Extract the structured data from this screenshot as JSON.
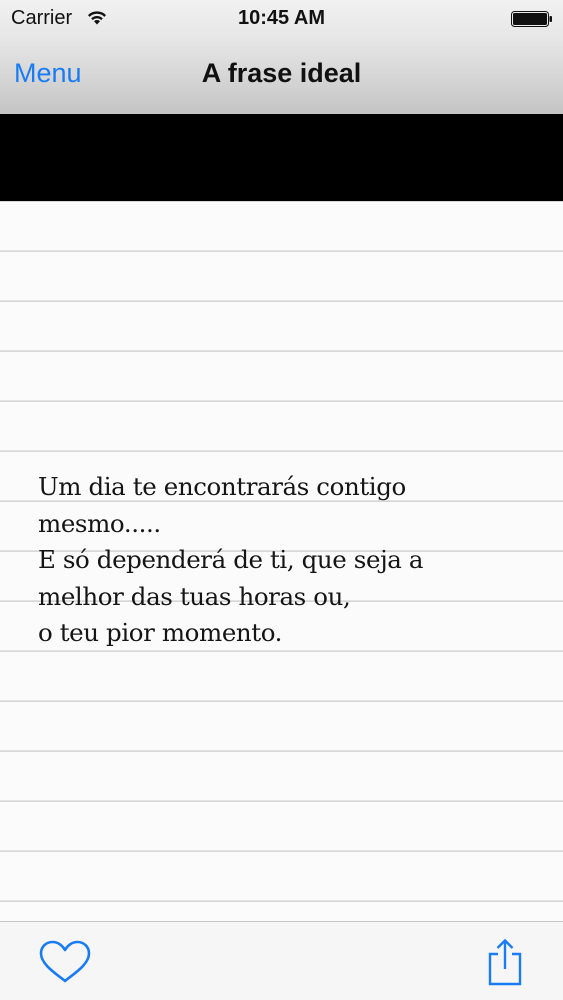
{
  "status_bar": {
    "carrier": "Carrier",
    "time": "10:45 AM",
    "wifi_icon": "wifi-icon",
    "battery_icon": "battery-icon"
  },
  "nav_bar": {
    "left_button": "Menu",
    "title": "A frase ideal"
  },
  "content": {
    "quote": "Um dia te encontrarás contigo\nmesmo.....\nE só dependerá de ti, que seja a\nmelhor das tuas horas ou,\no teu pior momento."
  },
  "toolbar": {
    "favorite_icon": "heart-icon",
    "share_icon": "share-icon"
  },
  "colors": {
    "accent": "#1a7cf5",
    "banner": "#000000",
    "text": "#151515"
  }
}
